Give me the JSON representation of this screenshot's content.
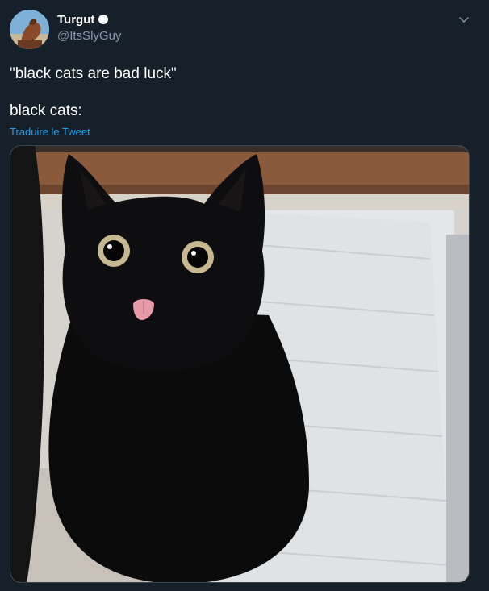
{
  "user": {
    "display_name": "Turgut",
    "handle": "@ItsSlyGuy",
    "verified_icon": "dot-badge-icon"
  },
  "menu": {
    "icon": "chevron-down-icon"
  },
  "tweet": {
    "line1": "\"black cats are bad luck\"",
    "line2": "black cats:",
    "translate_label": "Traduire le Tweet"
  },
  "media": {
    "subject": "black-cat-photo"
  },
  "colors": {
    "background": "#15202b",
    "text": "#ffffff",
    "secondary_text": "#8899a6",
    "link": "#1da1f2",
    "border": "#38444d"
  }
}
